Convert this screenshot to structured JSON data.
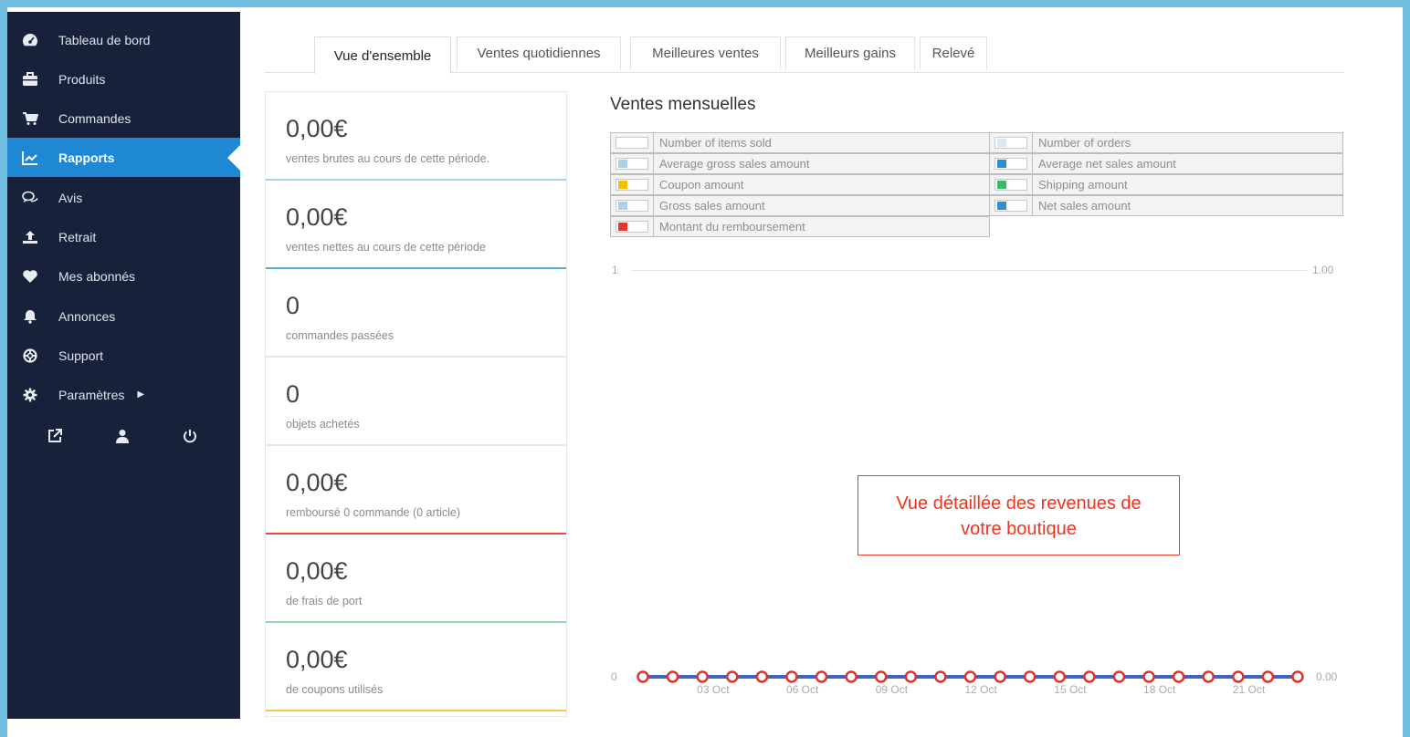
{
  "sidebar": {
    "items": [
      {
        "label": "Tableau de bord",
        "icon": "dashboard-icon"
      },
      {
        "label": "Produits",
        "icon": "briefcase-icon"
      },
      {
        "label": "Commandes",
        "icon": "cart-icon"
      },
      {
        "label": "Rapports",
        "icon": "chart-icon",
        "active": true
      },
      {
        "label": "Avis",
        "icon": "comments-icon"
      },
      {
        "label": "Retrait",
        "icon": "upload-icon"
      },
      {
        "label": "Mes abonnés",
        "icon": "heart-icon"
      },
      {
        "label": "Annonces",
        "icon": "bell-icon"
      },
      {
        "label": "Support",
        "icon": "lifebuoy-icon"
      },
      {
        "label": "Paramètres",
        "icon": "gear-icon"
      }
    ],
    "tools": [
      "external-link-icon",
      "user-icon",
      "power-icon"
    ]
  },
  "tabs": [
    "Vue d'ensemble",
    "Ventes quotidiennes",
    "Meilleures ventes",
    "Meilleurs gains",
    "Relevé"
  ],
  "stats": [
    {
      "value": "0,00€",
      "label": "ventes brutes au cours de cette période.",
      "color": "#a8d2ea"
    },
    {
      "value": "0,00€",
      "label": "ventes nettes au cours de cette période",
      "color": "#5aa9dc"
    },
    {
      "value": "0",
      "label": "commandes passées",
      "color": "#e6e6e6"
    },
    {
      "value": "0",
      "label": "objets achetés",
      "color": "#e6e6e6"
    },
    {
      "value": "0,00€",
      "label": "remboursé 0 commande (0 article)",
      "color": "#e74c3c"
    },
    {
      "value": "0,00€",
      "label": "de frais de port",
      "color": "#8fd6a8"
    },
    {
      "value": "0,00€",
      "label": "de coupons utilisés",
      "color": "#f2c94c"
    }
  ],
  "chart_title": "Ventes mensuelles",
  "legend": [
    {
      "label": "Number of items sold",
      "color": "#ffffff"
    },
    {
      "label": "Number of orders",
      "color": "#dbe8f0"
    },
    {
      "label": "Average gross sales amount",
      "color": "#a8d2ea"
    },
    {
      "label": "Average net sales amount",
      "color": "#2b8fd6"
    },
    {
      "label": "Coupon amount",
      "color": "#f2c200"
    },
    {
      "label": "Shipping amount",
      "color": "#3cba6a"
    },
    {
      "label": "Gross sales amount",
      "color": "#a8d2ea"
    },
    {
      "label": "Net sales amount",
      "color": "#2b8fd6"
    },
    {
      "label": "Montant du remboursement",
      "color": "#e03a2e"
    }
  ],
  "callout": {
    "line1": "Vue détaillée des revenues de",
    "line2": "votre boutique"
  },
  "chart_data": {
    "type": "line",
    "x_ticks": [
      "03 Oct",
      "06 Oct",
      "09 Oct",
      "12 Oct",
      "15 Oct",
      "18 Oct",
      "21 Oct"
    ],
    "left_axis": {
      "top": "1",
      "bottom": "0"
    },
    "right_axis": {
      "top": "1.00",
      "bottom": "0.00"
    },
    "series": [
      {
        "values": [
          0,
          0,
          0,
          0,
          0,
          0,
          0,
          0,
          0,
          0,
          0,
          0,
          0,
          0,
          0,
          0,
          0,
          0,
          0,
          0,
          0,
          0,
          0
        ]
      }
    ],
    "line_color": "#3f62c4",
    "marker_color": "#e0322a"
  }
}
